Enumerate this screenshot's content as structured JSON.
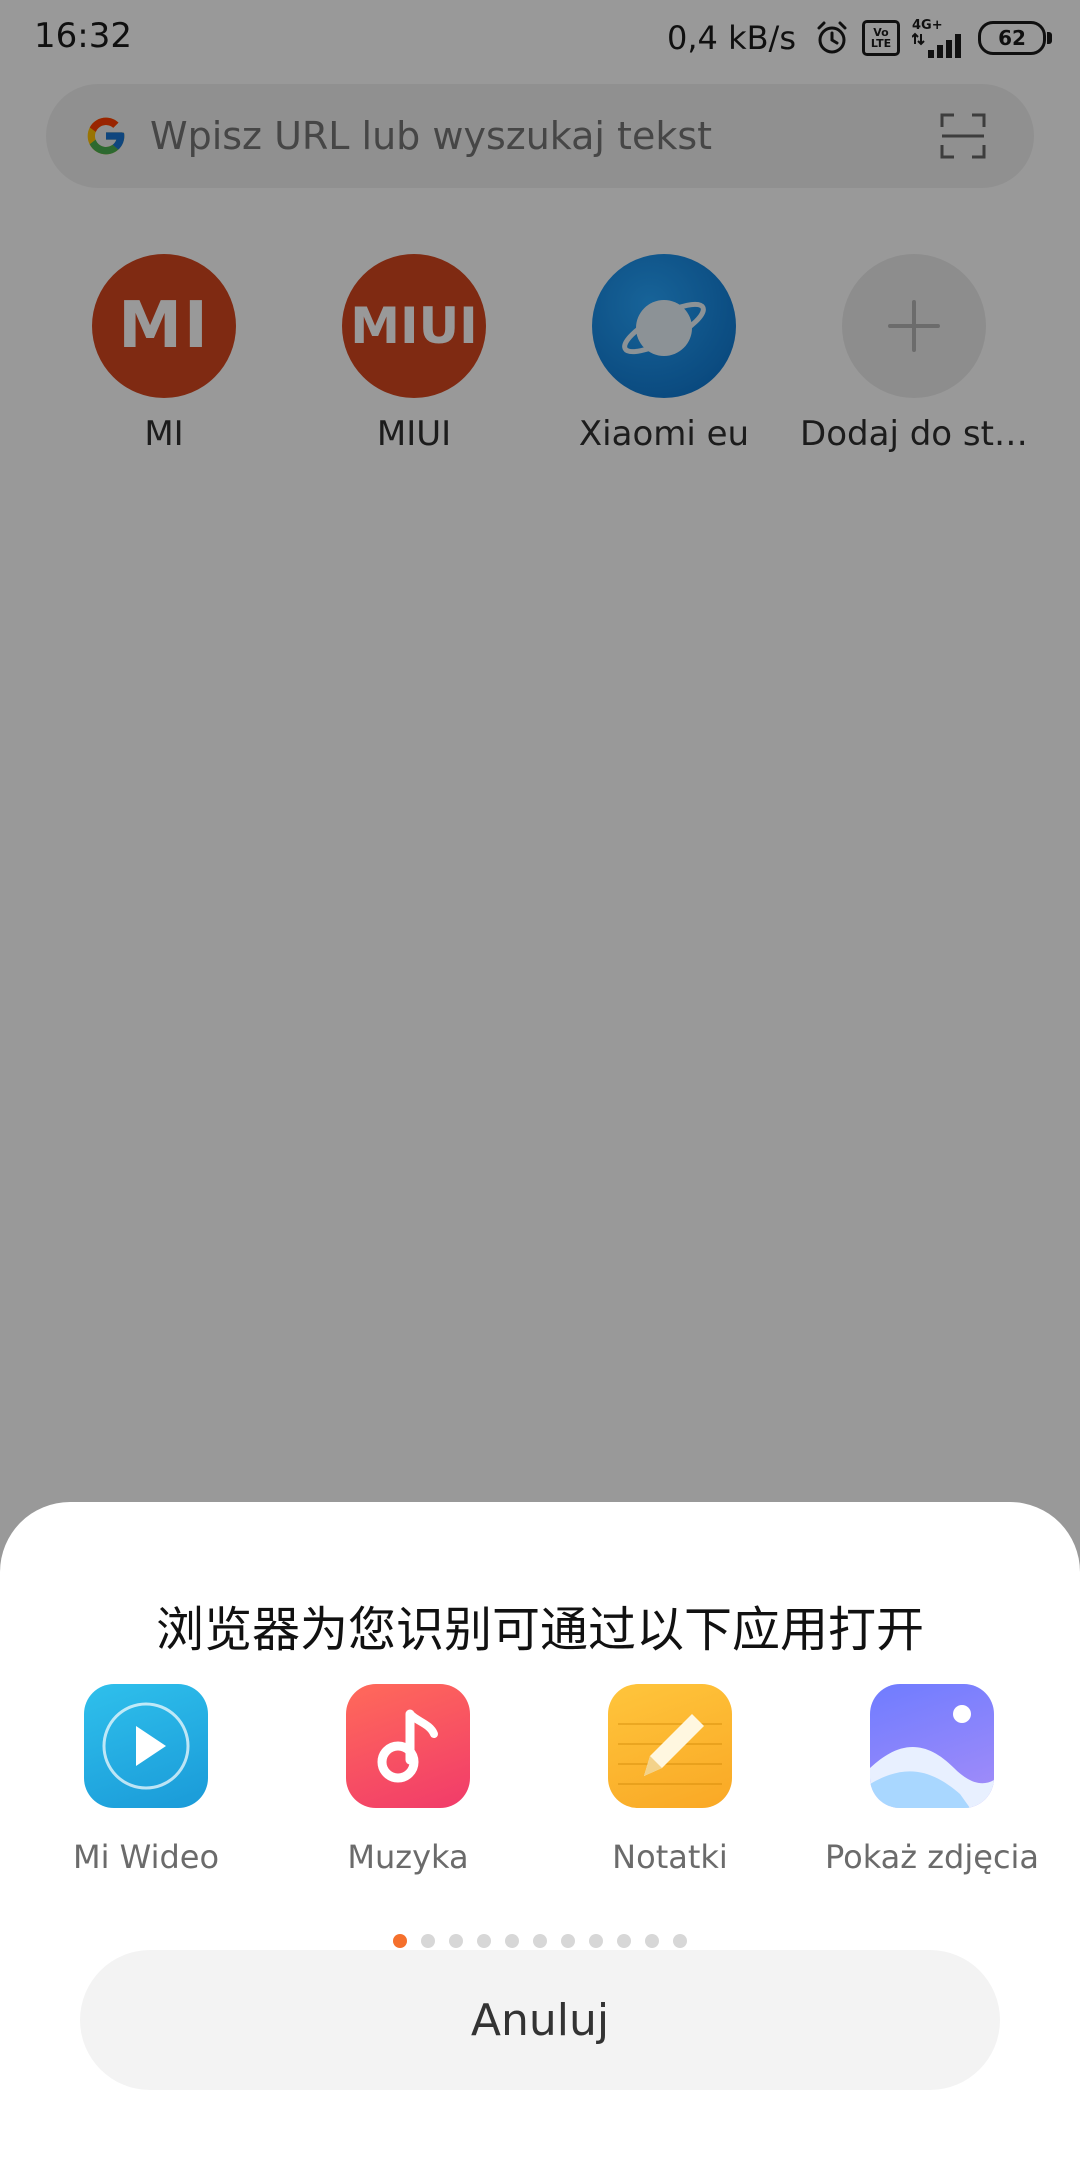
{
  "status_bar": {
    "time": "16:32",
    "net_speed": "0,4 kB/s",
    "volte_line1": "Vo",
    "volte_line2": "LTE",
    "network": "4G+",
    "battery": "62"
  },
  "search": {
    "placeholder": "Wpisz URL lub wyszukaj tekst"
  },
  "shortcuts": [
    {
      "label": "MI",
      "logo": "MI"
    },
    {
      "label": "MIUI",
      "logo": "MIUI"
    },
    {
      "label": "Xiaomi eu"
    },
    {
      "label": "Dodaj do st…"
    }
  ],
  "sheet": {
    "title": "浏览器为您识别可通过以下应用打开",
    "apps": [
      {
        "label": "Mi Wideo",
        "icon": "play-icon"
      },
      {
        "label": "Muzyka",
        "icon": "music-note-icon"
      },
      {
        "label": "Notatki",
        "icon": "pencil-icon"
      },
      {
        "label": "Pokaż zdjęcia",
        "icon": "gallery-icon"
      }
    ],
    "page_count": 11,
    "active_page": 1,
    "cancel_label": "Anuluj"
  },
  "colors": {
    "accent_dot": "#f5702c",
    "mi_brand": "#d4471f"
  }
}
